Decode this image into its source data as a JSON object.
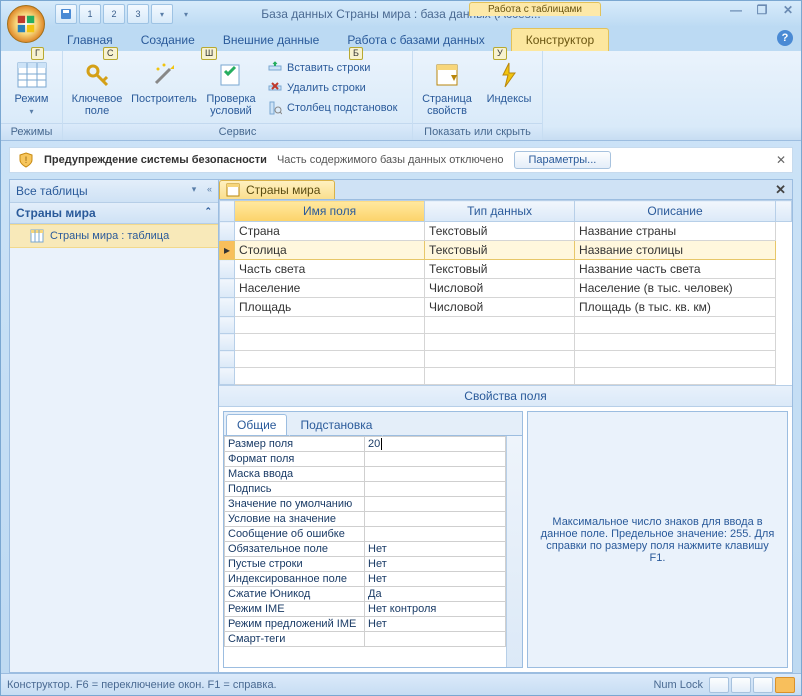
{
  "title": "База данных Страны мира : база данных (Acces...",
  "contextGroup": "Работа с таблицами",
  "tabs": [
    "Главная",
    "Создание",
    "Внешние данные",
    "Работа с базами данных"
  ],
  "contextTab": "Конструктор",
  "keytips": {
    "home": "Г",
    "create": "С",
    "external": "Ш",
    "dbtools": "Б",
    "design": "У"
  },
  "qat": [
    "1",
    "2",
    "3"
  ],
  "ribbon": {
    "g1": {
      "title": "Режимы",
      "mode": "Режим"
    },
    "g2": {
      "title": "Сервис",
      "key": "Ключевое поле",
      "builder": "Построитель",
      "test": "Проверка условий",
      "insert": "Вставить строки",
      "delete": "Удалить строки",
      "lookup": "Столбец подстановок"
    },
    "g3": {
      "title": "Показать или скрыть",
      "propsheet": "Страница свойств",
      "indexes": "Индексы"
    }
  },
  "security": {
    "title": "Предупреждение системы безопасности",
    "msg": "Часть содержимого базы данных отключено",
    "btn": "Параметры..."
  },
  "nav": {
    "header": "Все таблицы",
    "group": "Страны мира",
    "item": "Страны мира : таблица"
  },
  "docTab": "Страны мира",
  "gridHeaders": [
    "Имя поля",
    "Тип данных",
    "Описание"
  ],
  "fields": [
    {
      "name": "Страна",
      "type": "Текстовый",
      "desc": "Название страны"
    },
    {
      "name": "Столица",
      "type": "Текстовый",
      "desc": "Название столицы"
    },
    {
      "name": "Часть света",
      "type": "Текстовый",
      "desc": "Название часть света"
    },
    {
      "name": "Население",
      "type": "Числовой",
      "desc": "Население (в тыс. человек)"
    },
    {
      "name": "Площадь",
      "type": "Числовой",
      "desc": "Площадь (в тыс. кв. км)"
    }
  ],
  "propsHeader": "Свойства поля",
  "propTabs": [
    "Общие",
    "Подстановка"
  ],
  "props": [
    {
      "k": "Размер поля",
      "v": "20"
    },
    {
      "k": "Формат поля",
      "v": ""
    },
    {
      "k": "Маска ввода",
      "v": ""
    },
    {
      "k": "Подпись",
      "v": ""
    },
    {
      "k": "Значение по умолчанию",
      "v": ""
    },
    {
      "k": "Условие на значение",
      "v": ""
    },
    {
      "k": "Сообщение об ошибке",
      "v": ""
    },
    {
      "k": "Обязательное поле",
      "v": "Нет"
    },
    {
      "k": "Пустые строки",
      "v": "Нет"
    },
    {
      "k": "Индексированное поле",
      "v": "Нет"
    },
    {
      "k": "Сжатие Юникод",
      "v": "Да"
    },
    {
      "k": "Режим IME",
      "v": "Нет контроля"
    },
    {
      "k": "Режим предложений IME",
      "v": "Нет"
    },
    {
      "k": "Смарт-теги",
      "v": ""
    }
  ],
  "hint": "Максимальное число знаков для ввода в данное поле.  Предельное значение: 255.  Для справки по размеру поля нажмите клавишу F1.",
  "status": {
    "left": "Конструктор.  F6 = переключение окон.   F1 = справка.",
    "numlock": "Num Lock"
  }
}
